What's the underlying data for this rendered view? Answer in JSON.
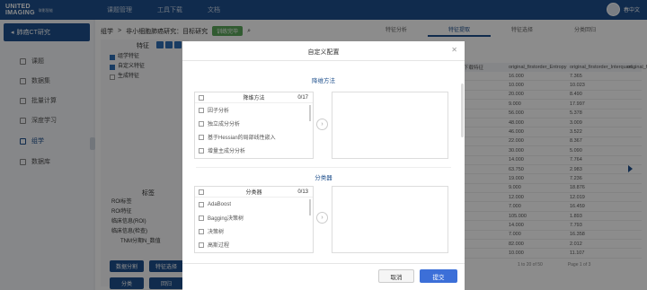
{
  "brand": {
    "name_line1": "UNITED",
    "name_line2": "IMAGING",
    "sub": "联影智能"
  },
  "topnav": [
    "课题管理",
    "工具下载",
    "文档"
  ],
  "user": {
    "name": "春中文"
  },
  "sidebar": {
    "project": "肺癌CT研究",
    "items": [
      {
        "label": "课题"
      },
      {
        "label": "数据集"
      },
      {
        "label": "批量计算"
      },
      {
        "label": "深度学习"
      },
      {
        "label": "组学"
      },
      {
        "label": "数据库"
      }
    ]
  },
  "breadcrumb": {
    "part1": "组学",
    "part2": "非小细胞肺癌研究：目标研究",
    "badge": "训练完毕"
  },
  "left_panel": {
    "feature_title": "特征",
    "tree": [
      {
        "label": "组学特征",
        "checked": true
      },
      {
        "label": "自定义特征",
        "checked": true
      },
      {
        "label": "生成特征",
        "checked": false
      }
    ],
    "label_title": "标签",
    "tags": [
      "ROI标签",
      "ROI特征",
      "临床信息(ROI)",
      "临床信息(检查)",
      "TNM分期N_数值"
    ],
    "buttons": [
      "数据分割",
      "特征选择",
      "分类",
      "回归"
    ]
  },
  "tabs": [
    "特征分析",
    "特征提取",
    "特征选择",
    "分类回归"
  ],
  "table": {
    "headers": [
      "下载特征",
      "original_firstorder_Entropy",
      "original_firstorder_Interquart...",
      "original_fi"
    ],
    "rows": [
      [
        "",
        "16.000",
        "7.365"
      ],
      [
        "",
        "10.000",
        "10.023"
      ],
      [
        "",
        "20.000",
        "8.490"
      ],
      [
        "",
        "9.000",
        "17.997"
      ],
      [
        "",
        "56.000",
        "5.378"
      ],
      [
        "",
        "48.000",
        "3.009"
      ],
      [
        "",
        "46.000",
        "3.522"
      ],
      [
        "",
        "22.000",
        "8.367"
      ],
      [
        "",
        "30.000",
        "5.090"
      ],
      [
        "",
        "14.000",
        "7.764"
      ],
      [
        "",
        "63.750",
        "2.983"
      ],
      [
        "",
        "19.000",
        "7.236"
      ],
      [
        "",
        "9.000",
        "18.876"
      ],
      [
        "",
        "12.000",
        "12.019"
      ],
      [
        "",
        "7.000",
        "16.459"
      ],
      [
        "",
        "105.000",
        "1.893"
      ],
      [
        "",
        "14.000",
        "7.793"
      ],
      [
        "",
        "7.000",
        "16.358"
      ],
      [
        "",
        "82.000",
        "2.012"
      ],
      [
        "",
        "10.000",
        "11.107"
      ]
    ],
    "pager_left": "1 to 20 of 50",
    "pager_right": "Page 1 of 3"
  },
  "modal": {
    "title": "自定义配置",
    "section1": "降维方法",
    "box1": {
      "title": "降维方法",
      "count": "0/17",
      "items": [
        "因子分析",
        "独立成分分析",
        "基于Hessian的局部线性嵌入",
        "增量主成分分析"
      ]
    },
    "section2": "分类器",
    "box2": {
      "title": "分类器",
      "count": "0/13",
      "items": [
        "AdaBoost",
        "Bagging决策树",
        "决策树",
        "高斯过程"
      ]
    },
    "cancel": "取消",
    "ok": "提交"
  }
}
